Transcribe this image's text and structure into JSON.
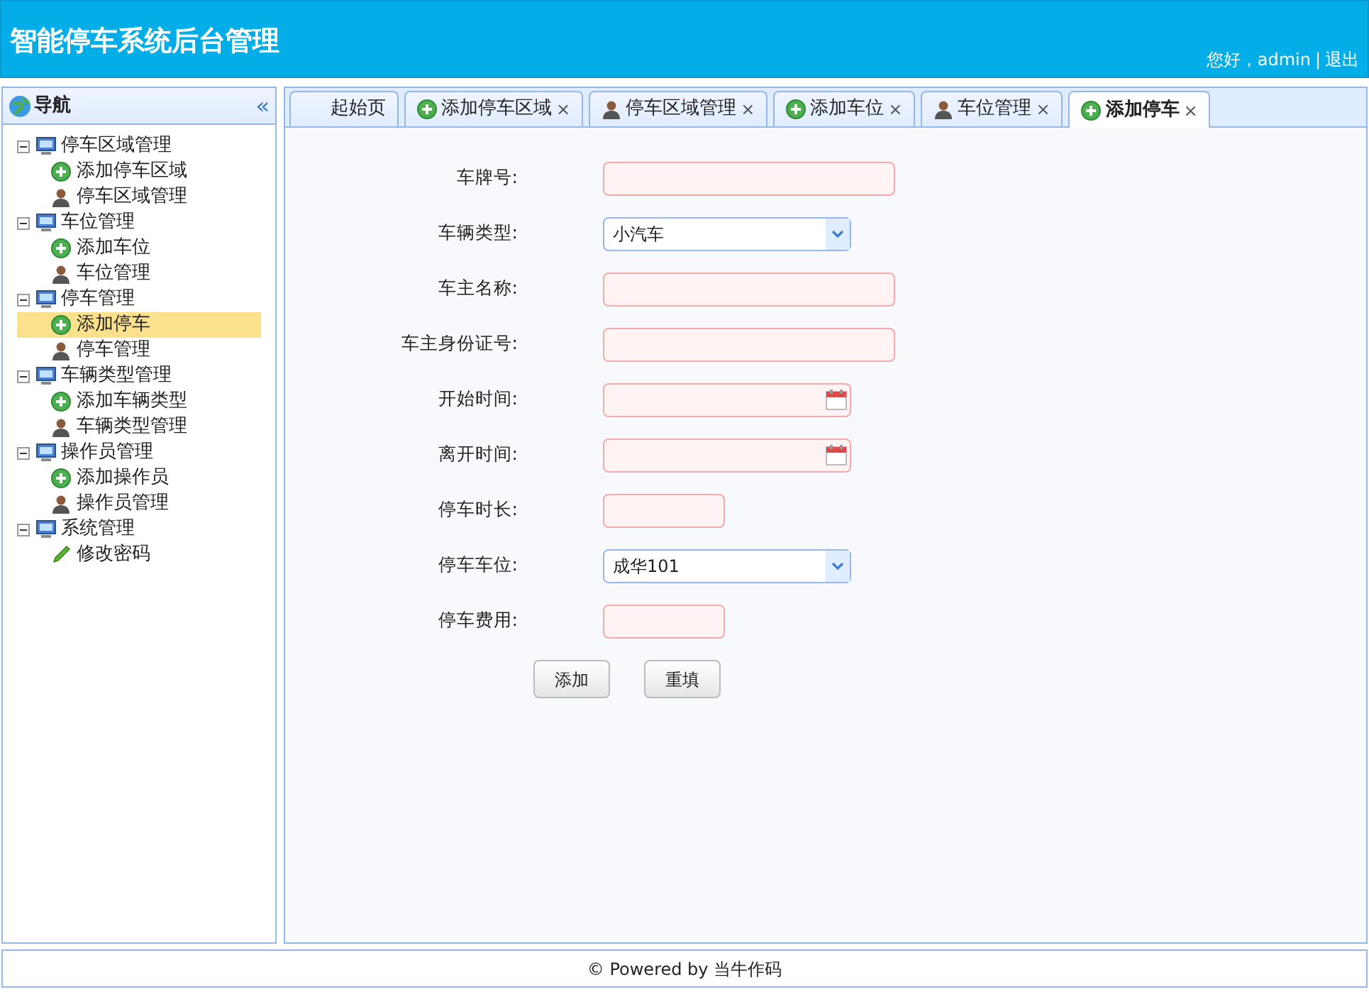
{
  "header": {
    "title": "智能停车系统后台管理",
    "greeting": "您好，admin",
    "separator": "|",
    "logout": "退出"
  },
  "sidebar": {
    "title": "导航",
    "collapse": "«",
    "tree": [
      {
        "label": "停车区域管理",
        "children": [
          {
            "label": "添加停车区域",
            "kind": "add",
            "selected": false
          },
          {
            "label": "停车区域管理",
            "kind": "user",
            "selected": false
          }
        ]
      },
      {
        "label": "车位管理",
        "children": [
          {
            "label": "添加车位",
            "kind": "add",
            "selected": false
          },
          {
            "label": "车位管理",
            "kind": "user",
            "selected": false
          }
        ]
      },
      {
        "label": "停车管理",
        "children": [
          {
            "label": "添加停车",
            "kind": "add",
            "selected": true
          },
          {
            "label": "停车管理",
            "kind": "user",
            "selected": false
          }
        ]
      },
      {
        "label": "车辆类型管理",
        "children": [
          {
            "label": "添加车辆类型",
            "kind": "add",
            "selected": false
          },
          {
            "label": "车辆类型管理",
            "kind": "user",
            "selected": false
          }
        ]
      },
      {
        "label": "操作员管理",
        "children": [
          {
            "label": "添加操作员",
            "kind": "add",
            "selected": false
          },
          {
            "label": "操作员管理",
            "kind": "user",
            "selected": false
          }
        ]
      },
      {
        "label": "系统管理",
        "children": [
          {
            "label": "修改密码",
            "kind": "pencil",
            "selected": false
          }
        ]
      }
    ]
  },
  "tabs": [
    {
      "label": "起始页",
      "kind": "home",
      "selected": false
    },
    {
      "label": "添加停车区域",
      "kind": "add",
      "selected": false
    },
    {
      "label": "停车区域管理",
      "kind": "user",
      "selected": false
    },
    {
      "label": "添加车位",
      "kind": "add",
      "selected": false
    },
    {
      "label": "车位管理",
      "kind": "user",
      "selected": false
    },
    {
      "label": "添加停车",
      "kind": "add",
      "selected": true
    }
  ],
  "tab_close": "×",
  "form": {
    "fields": [
      {
        "label": "车牌号:",
        "kind": "text"
      },
      {
        "label": "车辆类型:",
        "kind": "select",
        "value": "小汽车"
      },
      {
        "label": "车主名称:",
        "kind": "text"
      },
      {
        "label": "车主身份证号:",
        "kind": "text"
      },
      {
        "label": "开始时间:",
        "kind": "date"
      },
      {
        "label": "离开时间:",
        "kind": "date"
      },
      {
        "label": "停车时长:",
        "kind": "number"
      },
      {
        "label": "停车车位:",
        "kind": "select",
        "value": "成华101"
      },
      {
        "label": "停车费用:",
        "kind": "number"
      }
    ],
    "buttons": [
      "添加",
      "重填"
    ]
  },
  "footer": "© Powered by 当牛作码"
}
